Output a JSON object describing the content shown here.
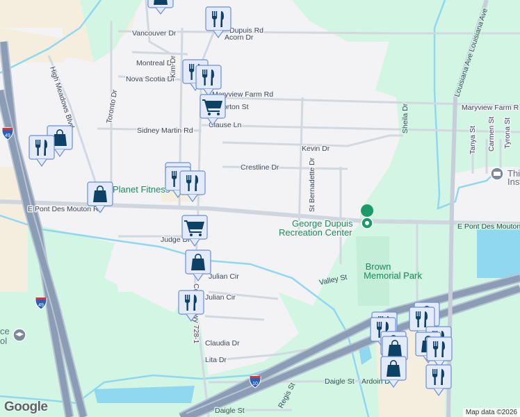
{
  "map": {
    "streets": {
      "vancouver": "Vancouver Dr",
      "dupuis": "Dupuis Rd",
      "acorn": "Acorn Dr",
      "montreal": "Montreal Dr",
      "nova_scotia": "Nova Scotia Dr",
      "maryview_farm": "Maryview Farm Rd",
      "maryview_farm_east": "Maryview Farm R",
      "morton": "Morton St",
      "clause": "Clause Ln",
      "sidney_martin": "Sidney Martin Rd",
      "toronto": "Toronto Dr",
      "high_meadows": "High Meadows Blvd",
      "kevin": "Kevin Dr",
      "crestline": "Crestline Dr",
      "st_bernadette": "St Bernadette Dr",
      "sheila": "Sheila Dr",
      "louisiana": "Louisiana Ave Louisiana Ave",
      "tanya": "Tanya St",
      "carmen": "Carmen St",
      "tyrona": "Tyrona St",
      "pont_des_mouton_west": "E Pont Des Mouton Rd",
      "pont_des_mouton_east": "E Pont Des Mouton",
      "judge": "Judge Dr",
      "julian1": "Julian Cir",
      "julian2": "Julian Cir",
      "county_hwy": "County Hwy 728-1",
      "claudia": "Claudia Dr",
      "lita": "Lita Dr",
      "valley": "Valley St",
      "daigle1": "Daigle St",
      "daigle2": "Daigle St",
      "ardoin": "Ardoin Dr",
      "regis": "Regis St",
      "kim": "Kim Dr"
    },
    "pois": {
      "planet_fitness": "Planet Fitness",
      "recreation_center_line1": "George Dupuis",
      "recreation_center_line2": "Recreation Center",
      "brown_park_line1": "Brown",
      "brown_park_line2": "Memorial Park",
      "institute_line1": "Thi",
      "institute_line2": "Inst",
      "school_line1": "ce",
      "school_line2": "ol"
    },
    "shields": {
      "i49_a": "49",
      "i49_b": "49",
      "i10": "10"
    },
    "marker_types": [
      "restaurant",
      "shopping-bag",
      "grocery-cart"
    ],
    "colors": {
      "marker_fill": "#e3ebfb",
      "marker_border": "#6a8ed6",
      "marker_icon": "#0d4166",
      "park": "#d3f5e3",
      "water": "#8fd8ef",
      "highway": "#8b9cb5"
    },
    "attribution": "Map data ©2026",
    "logo": "Google"
  }
}
